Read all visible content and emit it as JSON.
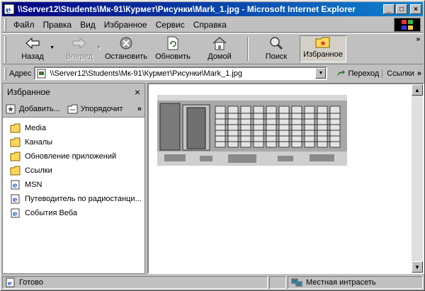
{
  "window": {
    "title": "\\\\Server12\\Students\\Мк-91\\Курмет\\Рисунки\\Mark_1.jpg - Microsoft Internet Explorer",
    "minimize": "_",
    "maximize": "□",
    "close": "×"
  },
  "menu": [
    {
      "label": "Файл"
    },
    {
      "label": "Правка"
    },
    {
      "label": "Вид"
    },
    {
      "label": "Избранное"
    },
    {
      "label": "Сервис"
    },
    {
      "label": "Справка"
    }
  ],
  "toolbar": {
    "back": "Назад",
    "forward": "Вперед",
    "stop": "Остановить",
    "refresh": "Обновить",
    "home": "Домой",
    "search": "Поиск",
    "favorites": "Избранное",
    "more": "»"
  },
  "address": {
    "label": "Адрес",
    "value": "\\\\Server12\\Students\\Мк-91\\Курмет\\Рисунки\\Mark_1.jpg",
    "go": "Переход",
    "links": "Ссылки",
    "more": "»"
  },
  "favorites_pane": {
    "title": "Избранное",
    "close": "×",
    "add": "Добавить...",
    "organize": "Упорядочит",
    "more": "»",
    "items": [
      {
        "label": "Media",
        "icon": "folder-icon"
      },
      {
        "label": "Каналы",
        "icon": "folder-icon"
      },
      {
        "label": "Обновление приложений",
        "icon": "folder-icon"
      },
      {
        "label": "Ссылки",
        "icon": "folder-icon"
      },
      {
        "label": "MSN",
        "icon": "ie-link-icon"
      },
      {
        "label": "Путеводитель по радиостанци...",
        "icon": "ie-link-icon"
      },
      {
        "label": "События Веба",
        "icon": "ie-link-icon"
      }
    ]
  },
  "status": {
    "text": "Готово",
    "zone": "Местная интрасеть"
  },
  "colors": {
    "titlebar_start": "#000080",
    "titlebar_end": "#1084d0",
    "face": "#c0c0c0",
    "folder": "#ffd85a"
  }
}
